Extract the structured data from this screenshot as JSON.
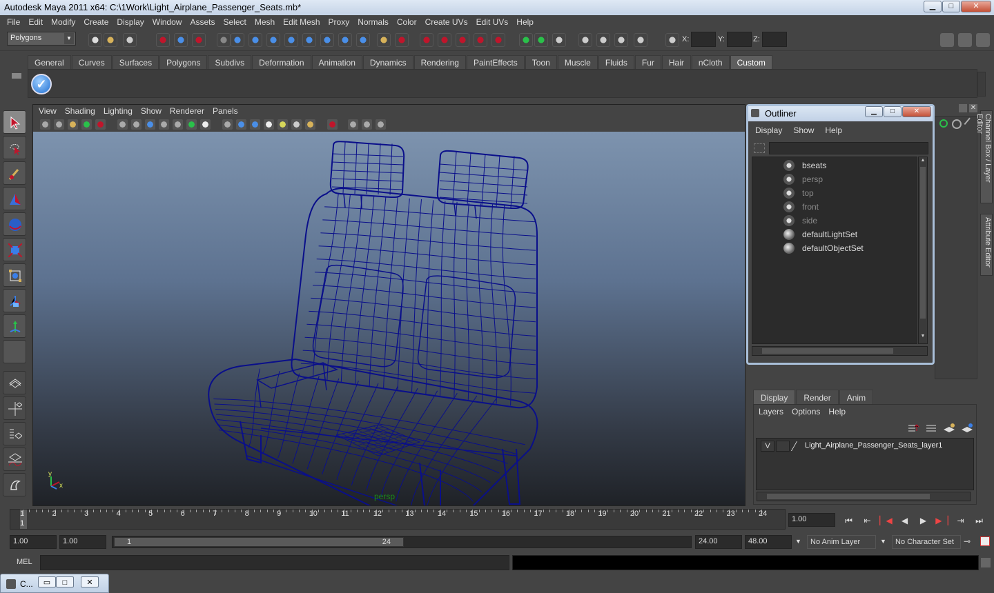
{
  "window": {
    "title": "Autodesk Maya 2011 x64: C:\\1Work\\Light_Airplane_Passenger_Seats.mb*",
    "min_label": "▁",
    "max_label": "□",
    "close_label": "✕"
  },
  "menubar": [
    "File",
    "Edit",
    "Modify",
    "Create",
    "Display",
    "Window",
    "Assets",
    "Select",
    "Mesh",
    "Edit Mesh",
    "Proxy",
    "Normals",
    "Color",
    "Create UVs",
    "Edit UVs",
    "Help"
  ],
  "statusline": {
    "mode": "Polygons",
    "x_label": "X:",
    "y_label": "Y:",
    "z_label": "Z:"
  },
  "shelf": {
    "tabs": [
      "General",
      "Curves",
      "Surfaces",
      "Polygons",
      "Subdivs",
      "Deformation",
      "Animation",
      "Dynamics",
      "Rendering",
      "PaintEffects",
      "Toon",
      "Muscle",
      "Fluids",
      "Fur",
      "Hair",
      "nCloth",
      "Custom"
    ],
    "active_tab": "Custom",
    "check_icon": "✓"
  },
  "viewport": {
    "menu": [
      "View",
      "Shading",
      "Lighting",
      "Show",
      "Renderer",
      "Panels"
    ],
    "camera_label": "persp",
    "axis_y": "y",
    "axis_x": "x",
    "wire_color": "#0a0f8a"
  },
  "outliner": {
    "title": "Outliner",
    "menu": [
      "Display",
      "Show",
      "Help"
    ],
    "items": [
      {
        "label": "bseats",
        "dim": false
      },
      {
        "label": "persp",
        "dim": true
      },
      {
        "label": "top",
        "dim": true
      },
      {
        "label": "front",
        "dim": true
      },
      {
        "label": "side",
        "dim": true
      },
      {
        "label": "defaultLightSet",
        "dim": false
      },
      {
        "label": "defaultObjectSet",
        "dim": false
      }
    ]
  },
  "side_tabs": {
    "channel_box": "Channel Box / Layer Editor",
    "attribute_editor": "Attribute Editor"
  },
  "layer_editor": {
    "tabs": [
      "Display",
      "Render",
      "Anim"
    ],
    "active_tab": "Display",
    "menu": [
      "Layers",
      "Options",
      "Help"
    ],
    "layer": {
      "visible": "V",
      "name": "Light_Airplane_Passenger_Seats_layer1"
    }
  },
  "time_slider": {
    "ticks": [
      1,
      2,
      3,
      4,
      5,
      6,
      7,
      8,
      9,
      10,
      11,
      12,
      13,
      14,
      15,
      16,
      17,
      18,
      19,
      20,
      21,
      22,
      23,
      24
    ],
    "current_frame": "1",
    "current_time": "1.00"
  },
  "range": {
    "start_time": "1.00",
    "playback_start": "1.00",
    "slider_start": "1",
    "slider_end": "24",
    "playback_end": "24.00",
    "end_time": "48.00",
    "anim_layer": "No Anim Layer",
    "character_set": "No Character Set"
  },
  "command_line": {
    "label": "MEL"
  },
  "minimized_window": {
    "title": "C..."
  }
}
